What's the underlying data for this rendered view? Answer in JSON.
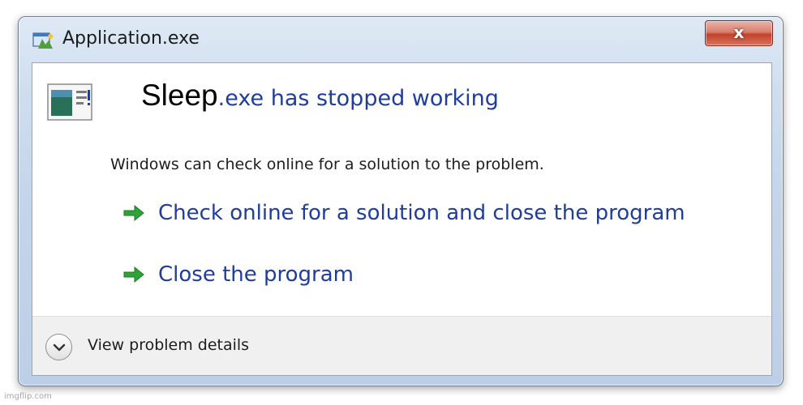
{
  "window": {
    "title": "Application.exe",
    "close_label": "x"
  },
  "dialog": {
    "program_name": "Sleep",
    "headline_rest": ".exe has stopped working",
    "message": "Windows can check online for a solution to the problem.",
    "actions": [
      {
        "label": "Check online for a solution and close the program",
        "icon": "green-arrow-icon"
      },
      {
        "label": "Close the program",
        "icon": "green-arrow-icon"
      }
    ],
    "details_label": "View problem details"
  },
  "watermark": "imgflip.com",
  "colors": {
    "link_blue": "#1f3d9a",
    "arrow_green": "#2fa33a",
    "close_red": "#c2432c"
  }
}
